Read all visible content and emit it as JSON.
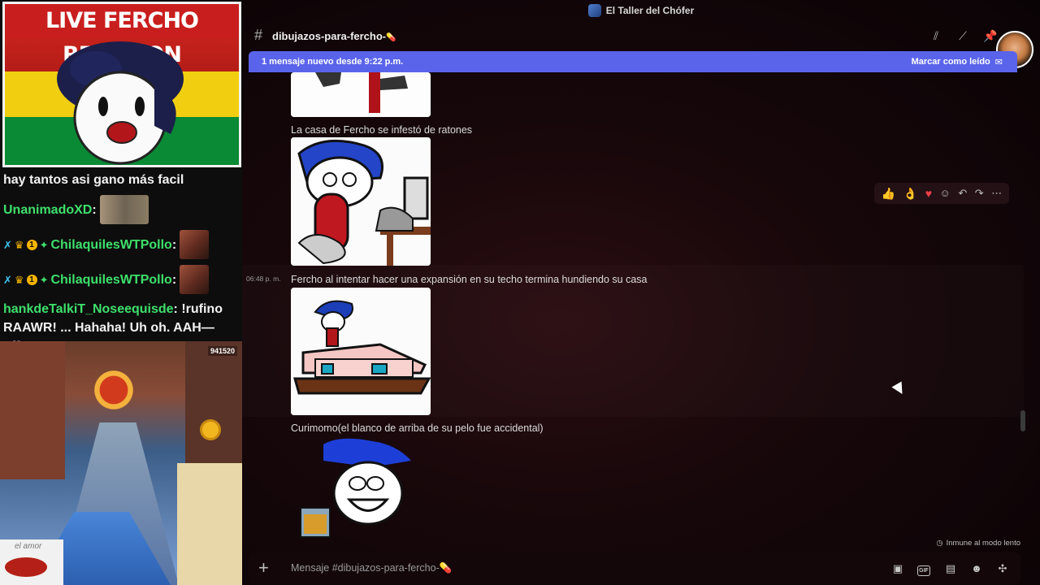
{
  "stream": {
    "cam_title": "LIVE FERCHO REACTION",
    "game_score": "941520",
    "mini_label": "el amor"
  },
  "chat": {
    "lines": [
      {
        "text": "hay tantos asi gano más facil"
      },
      {
        "user": "UnanimadoXD",
        "user_color": "#3ee06b",
        "sep": ":"
      },
      {
        "user": "ChilaquilesWTPollo",
        "user_color": "#3ee06b",
        "sep": ":",
        "badge_num": "1"
      },
      {
        "user": "ChilaquilesWTPollo",
        "user_color": "#3ee06b",
        "sep": ":",
        "badge_num": "1"
      },
      {
        "user": "hankdeTalkiT_Noseequisde",
        "user_color": "#3ee06b",
        "sep": ":",
        "text": "!rufino RAAWR! ... Hahaha! Uh oh. AAH—pffrt! HAHAHA."
      }
    ]
  },
  "discord": {
    "window_title": "El Taller del Chófer",
    "channel_name": "dibujazos-para-fercho-",
    "channel_emoji": "💊",
    "new_banner": {
      "text": "1 mensaje nuevo desde 9:22 p.m.",
      "action": "Marcar como leído"
    },
    "messages": [
      {
        "text": "La casa de Fercho se infestó de ratones"
      },
      {
        "timestamp": "06:48 p. m.",
        "text": "Fercho al intentar hacer una expansión en su techo termina hundiendo su casa"
      },
      {
        "text": "Curimomo(el blanco de arriba de su pelo fue accidental)"
      }
    ],
    "reactions": [
      "👍",
      "👌",
      "❤️"
    ],
    "slowmode_text": "Inmune al modo lento",
    "composer_placeholder": "Mensaje #dibujazos-para-fercho-💊",
    "colors": {
      "banner": "#5a64ea",
      "background": "#16070a"
    }
  }
}
